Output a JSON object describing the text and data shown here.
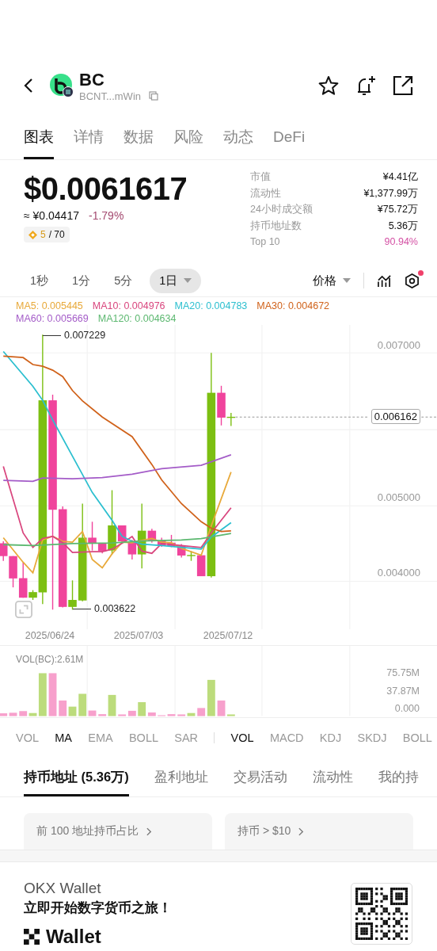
{
  "header": {
    "title": "BC",
    "address": "BCNT...mWin"
  },
  "tabs": [
    {
      "label": "图表",
      "selected": true
    },
    {
      "label": "详情",
      "selected": false
    },
    {
      "label": "数据",
      "selected": false
    },
    {
      "label": "风险",
      "selected": false
    },
    {
      "label": "动态",
      "selected": false
    },
    {
      "label": "DeFi",
      "selected": false
    }
  ],
  "price": {
    "value": "$0.0061617",
    "converted": "≈ ¥0.04417",
    "change": "-1.79%",
    "rank": "5",
    "rank_total": "/ 70"
  },
  "stats": [
    {
      "label": "市值",
      "value": "¥4.41亿",
      "highlight": false
    },
    {
      "label": "流动性",
      "value": "¥1,377.99万",
      "highlight": false
    },
    {
      "label": "24小时成交额",
      "value": "¥75.72万",
      "highlight": false
    },
    {
      "label": "持币地址数",
      "value": "5.36万",
      "highlight": false
    },
    {
      "label": "Top 10",
      "value": "90.94%",
      "highlight": true
    }
  ],
  "timeframes": [
    {
      "label": "1秒",
      "selected": false
    },
    {
      "label": "1分",
      "selected": false
    },
    {
      "label": "5分",
      "selected": false
    },
    {
      "label": "1日",
      "selected": true
    }
  ],
  "price_mode": "价格",
  "settings_alert": true,
  "chart": {
    "legend": [
      {
        "text": "MA5: 0.005445",
        "color": "#e8a93a"
      },
      {
        "text": "MA10: 0.004976",
        "color": "#d9467e"
      },
      {
        "text": "MA20: 0.004783",
        "color": "#2bbfcf"
      },
      {
        "text": "MA30: 0.004672",
        "color": "#d0621a"
      },
      {
        "text": "MA60: 0.005669",
        "color": "#a45cc8"
      },
      {
        "text": "MA120: 0.004634",
        "color": "#5cb870"
      }
    ],
    "high": "0.007229",
    "low": "0.003622",
    "yticks": [
      "0.007000",
      "0.005000",
      "0.004000"
    ],
    "last_price": "0.006162",
    "dates": [
      "2025/06/24",
      "2025/07/03",
      "2025/07/12"
    ]
  },
  "volume": {
    "title": "VOL(BC):2.61M",
    "yticks": [
      "75.75M",
      "37.87M",
      "0.000"
    ]
  },
  "indicators": {
    "main": [
      {
        "label": "VOL",
        "selected": false
      },
      {
        "label": "MA",
        "selected": true
      },
      {
        "label": "EMA",
        "selected": false
      },
      {
        "label": "BOLL",
        "selected": false
      },
      {
        "label": "SAR",
        "selected": false
      }
    ],
    "sub": [
      {
        "label": "VOL",
        "selected": true
      },
      {
        "label": "MACD",
        "selected": false
      },
      {
        "label": "KDJ",
        "selected": false
      },
      {
        "label": "SKDJ",
        "selected": false
      },
      {
        "label": "BOLL",
        "selected": false
      }
    ]
  },
  "holder_tabs": [
    {
      "label": "持币地址 (5.36万)",
      "selected": true
    },
    {
      "label": "盈利地址",
      "selected": false
    },
    {
      "label": "交易活动",
      "selected": false
    },
    {
      "label": "流动性",
      "selected": false
    },
    {
      "label": "我的持",
      "selected": false
    }
  ],
  "cards": [
    {
      "label": "前 100 地址持币占比"
    },
    {
      "label": "持币 > $10"
    }
  ],
  "banner": {
    "title": "OKX Wallet",
    "slogan": "立即开始数字货币之旅！",
    "brand": "Wallet"
  }
}
